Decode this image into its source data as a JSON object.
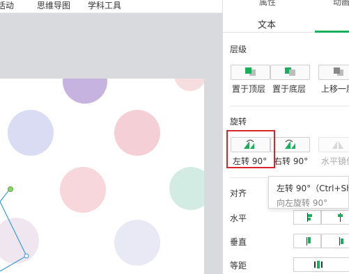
{
  "menu": {
    "items": [
      "活动",
      "思维导图",
      "学科工具"
    ]
  },
  "panel": {
    "top_tabs": [
      "属性",
      "动画"
    ],
    "tab_text": "文本",
    "layer": {
      "title": "层级",
      "buttons": [
        "置于顶层",
        "置于底层",
        "上移一层"
      ]
    },
    "rotate": {
      "title": "旋转",
      "buttons": [
        "左转 90°",
        "右转 90°",
        "水平镜像"
      ]
    },
    "align": {
      "title": "对齐",
      "horizontal": "水平",
      "vertical": "垂直",
      "spacing": "等距"
    }
  },
  "tooltip": {
    "title": "左转 90°（Ctrl+Shift",
    "desc": "向左旋转 90°"
  },
  "colors": {
    "accent": "#1aaf5d",
    "highlight": "#d6262b",
    "selection": "#3a9ad9"
  }
}
